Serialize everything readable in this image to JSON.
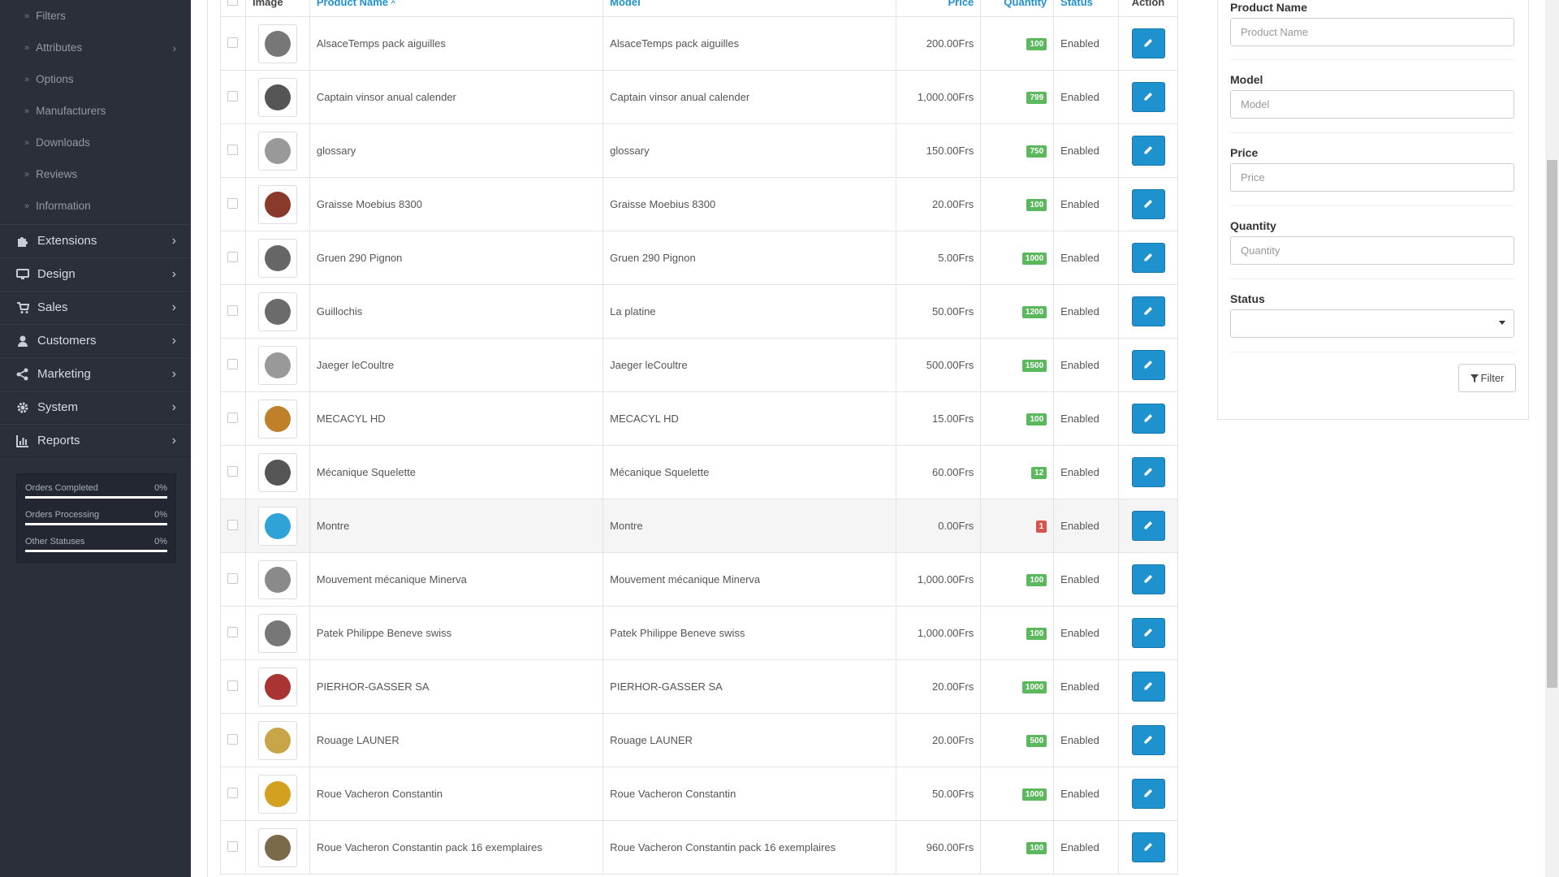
{
  "sidebar": {
    "sub_items": [
      {
        "label": "Filters",
        "chevron": false
      },
      {
        "label": "Attributes",
        "chevron": true
      },
      {
        "label": "Options",
        "chevron": false
      },
      {
        "label": "Manufacturers",
        "chevron": false
      },
      {
        "label": "Downloads",
        "chevron": false
      },
      {
        "label": "Reviews",
        "chevron": false
      },
      {
        "label": "Information",
        "chevron": false
      }
    ],
    "main_items": [
      {
        "label": "Extensions",
        "icon": "puzzle-icon"
      },
      {
        "label": "Design",
        "icon": "desktop-icon"
      },
      {
        "label": "Sales",
        "icon": "cart-icon"
      },
      {
        "label": "Customers",
        "icon": "user-icon"
      },
      {
        "label": "Marketing",
        "icon": "share-icon"
      },
      {
        "label": "System",
        "icon": "gear-icon"
      },
      {
        "label": "Reports",
        "icon": "bar-chart-icon"
      }
    ],
    "stats": [
      {
        "label": "Orders Completed",
        "value": "0%",
        "progress": 0
      },
      {
        "label": "Orders Processing",
        "value": "0%",
        "progress": 0
      },
      {
        "label": "Other Statuses",
        "value": "0%",
        "progress": 0
      }
    ]
  },
  "table": {
    "headers": {
      "image": "Image",
      "name": "Product Name",
      "model": "Model",
      "price": "Price",
      "quantity": "Quantity",
      "status": "Status",
      "action": "Action"
    },
    "rows": [
      {
        "name": "AlsaceTemps pack aiguilles",
        "model": "AlsaceTemps pack aiguilles",
        "price": "200.00Frs",
        "quantity": "100",
        "status": "Enabled",
        "low": false
      },
      {
        "name": "Captain vinsor anual calender",
        "model": "Captain vinsor anual calender",
        "price": "1,000.00Frs",
        "quantity": "799",
        "status": "Enabled",
        "low": false
      },
      {
        "name": "glossary",
        "model": "glossary",
        "price": "150.00Frs",
        "quantity": "750",
        "status": "Enabled",
        "low": false
      },
      {
        "name": "Graisse Moebius 8300",
        "model": "Graisse Moebius 8300",
        "price": "20.00Frs",
        "quantity": "100",
        "status": "Enabled",
        "low": false
      },
      {
        "name": "Gruen 290 Pignon",
        "model": "Gruen 290 Pignon",
        "price": "5.00Frs",
        "quantity": "1000",
        "status": "Enabled",
        "low": false
      },
      {
        "name": "Guillochis",
        "model": "La platine",
        "price": "50.00Frs",
        "quantity": "1200",
        "status": "Enabled",
        "low": false
      },
      {
        "name": "Jaeger leCoultre",
        "model": "Jaeger leCoultre",
        "price": "500.00Frs",
        "quantity": "1500",
        "status": "Enabled",
        "low": false
      },
      {
        "name": "MECACYL HD",
        "model": "MECACYL HD",
        "price": "15.00Frs",
        "quantity": "100",
        "status": "Enabled",
        "low": false
      },
      {
        "name": "Mécanique Squelette",
        "model": "Mécanique Squelette",
        "price": "60.00Frs",
        "quantity": "12",
        "status": "Enabled",
        "low": false
      },
      {
        "name": "Montre",
        "model": "Montre",
        "price": "0.00Frs",
        "quantity": "1",
        "status": "Enabled",
        "low": true
      },
      {
        "name": "Mouvement mécanique Minerva",
        "model": "Mouvement mécanique Minerva",
        "price": "1,000.00Frs",
        "quantity": "100",
        "status": "Enabled",
        "low": false
      },
      {
        "name": "Patek Philippe Beneve swiss",
        "model": "Patek Philippe Beneve swiss",
        "price": "1,000.00Frs",
        "quantity": "100",
        "status": "Enabled",
        "low": false
      },
      {
        "name": "PIERHOR-GASSER SA",
        "model": "PIERHOR-GASSER SA",
        "price": "20.00Frs",
        "quantity": "1000",
        "status": "Enabled",
        "low": false
      },
      {
        "name": "Rouage LAUNER",
        "model": "Rouage LAUNER",
        "price": "20.00Frs",
        "quantity": "500",
        "status": "Enabled",
        "low": false
      },
      {
        "name": "Roue Vacheron Constantin",
        "model": "Roue Vacheron Constantin",
        "price": "50.00Frs",
        "quantity": "1000",
        "status": "Enabled",
        "low": false
      },
      {
        "name": "Roue Vacheron Constantin pack 16 exemplaires",
        "model": "Roue Vacheron Constantin pack 16 exemplaires",
        "price": "960.00Frs",
        "quantity": "100",
        "status": "Enabled",
        "low": false
      }
    ]
  },
  "filter": {
    "product_name_label": "Product Name",
    "product_name_placeholder": "Product Name",
    "model_label": "Model",
    "model_placeholder": "Model",
    "price_label": "Price",
    "price_placeholder": "Price",
    "quantity_label": "Quantity",
    "quantity_placeholder": "Quantity",
    "status_label": "Status",
    "status_value": "",
    "button_label": "Filter"
  },
  "colors": {
    "accent": "#1e91cf",
    "badge_ok": "#5cb85c",
    "badge_low": "#d9534f",
    "sidebar_bg": "#2a2f3a"
  }
}
